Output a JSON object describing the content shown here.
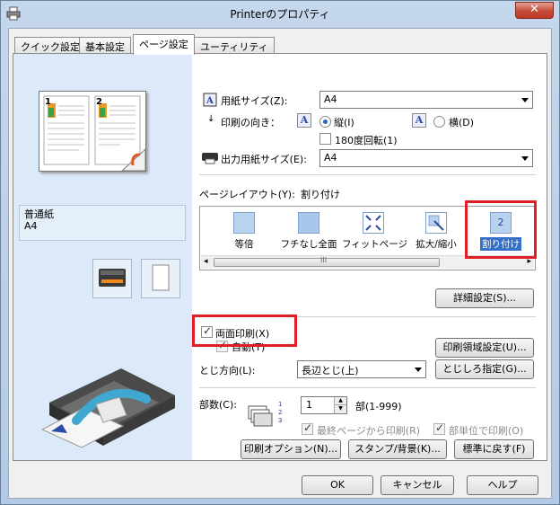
{
  "window": {
    "title": "Printerのプロパティ",
    "close_glyph": "✕"
  },
  "tabs": [
    {
      "label": "クイック設定"
    },
    {
      "label": "基本設定"
    },
    {
      "label": "ページ設定"
    },
    {
      "label": "ユーティリティ"
    }
  ],
  "left": {
    "paper_type": "普通紙",
    "paper_size": "A4",
    "page_numbers": [
      "1",
      "2"
    ]
  },
  "paper": {
    "size_label": "用紙サイズ(Z):",
    "size_value": "A4",
    "orientation_label": "印刷の向き：",
    "portrait_label": "縦(I)",
    "landscape_label": "横(D)",
    "orientation_icon_text": "A",
    "rotate_label": "180度回転(1)",
    "output_size_label": "出力用紙サイズ(E):",
    "output_size_value": "A4"
  },
  "layout": {
    "label": "ページレイアウト(Y):",
    "current": "割り付け",
    "items": [
      {
        "label": "等倍"
      },
      {
        "label": "フチなし全面"
      },
      {
        "label": "フィットページ"
      },
      {
        "label": "拡大/縮小"
      },
      {
        "label": "割り付け",
        "icon_text": "2"
      }
    ],
    "scroll_grip": "III",
    "scroll_left": "◂",
    "scroll_right": "▸"
  },
  "buttons": {
    "details": "詳細設定(S)...",
    "print_area": "印刷領域設定(U)...",
    "margin": "とじしろ指定(G)...",
    "options": "印刷オプション(N)...",
    "stamp": "スタンプ/背景(K)...",
    "defaults": "標準に戻す(F)",
    "ok": "OK",
    "cancel": "キャンセル",
    "help": "ヘルプ"
  },
  "duplex": {
    "label": "両面印刷(X)",
    "auto_label": "自動(T)",
    "binding_label": "とじ方向(L):",
    "binding_value": "長辺とじ(上)"
  },
  "copies": {
    "label": "部数(C):",
    "value": "1",
    "range": "部(1-999)",
    "reverse_label": "最終ページから印刷(R)",
    "collate_label": "部単位で印刷(O)",
    "collate_digits": "1 2 3"
  },
  "colors": {
    "highlight": "#e01e28",
    "accent": "#3370c8"
  }
}
